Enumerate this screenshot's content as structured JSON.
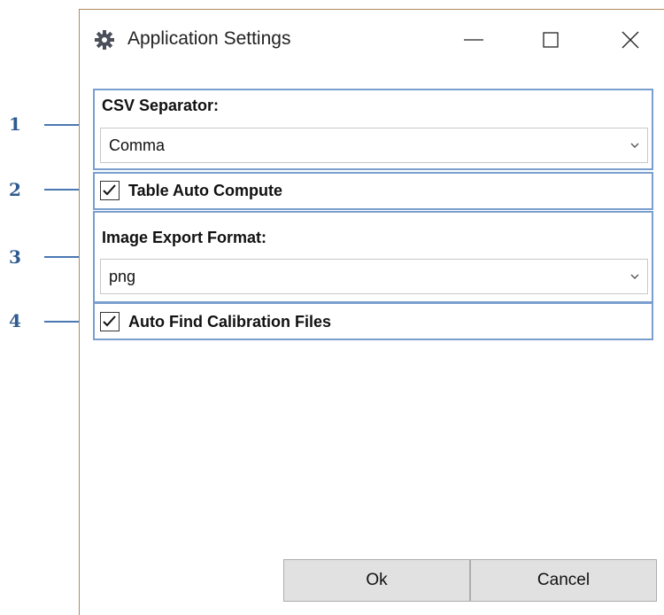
{
  "window": {
    "title": "Application Settings",
    "title_icon": "gear-icon",
    "controls": [
      "minimize-icon",
      "maximize-icon",
      "close-icon"
    ]
  },
  "callouts": [
    "1",
    "2",
    "3",
    "4"
  ],
  "settings": {
    "csv_separator": {
      "label": "CSV Separator:",
      "selected": "Comma"
    },
    "table_auto_compute": {
      "label": "Table Auto Compute",
      "checked": true
    },
    "image_export_format": {
      "label": "Image Export Format:",
      "selected": "png"
    },
    "auto_find_calibration": {
      "label": "Auto Find Calibration Files",
      "checked": true
    }
  },
  "buttons": {
    "ok": "Ok",
    "cancel": "Cancel"
  },
  "colors": {
    "callout_text": "#2e5a8f",
    "highlight_border": "#7a9fcf",
    "button_bg": "#e1e1e1"
  }
}
